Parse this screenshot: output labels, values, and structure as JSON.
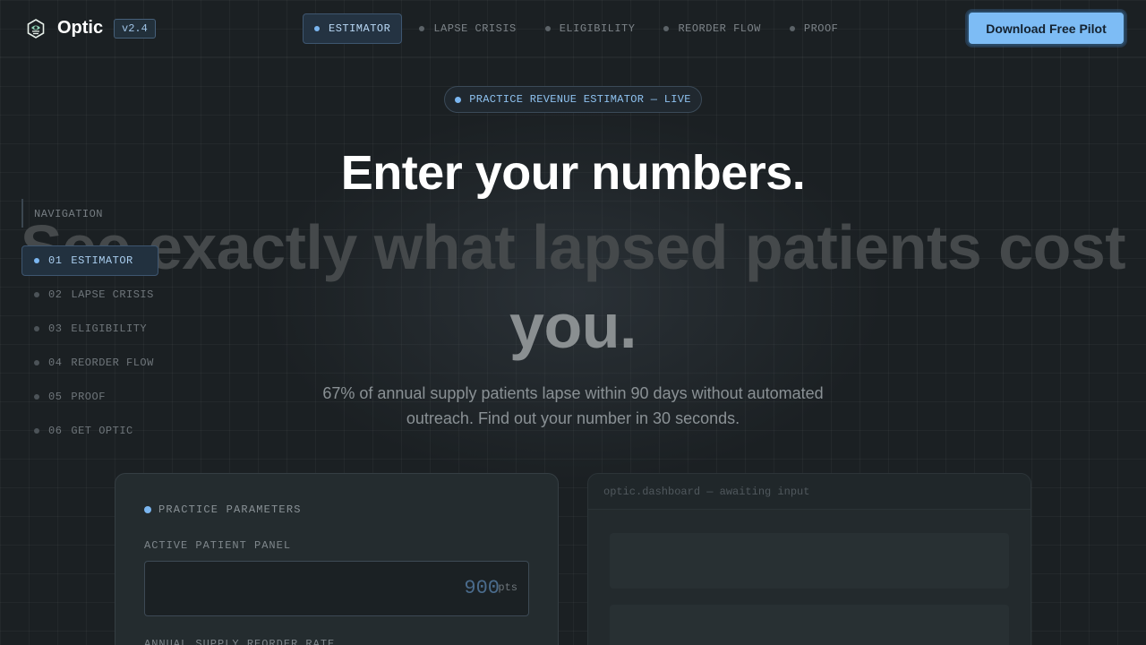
{
  "header": {
    "brand": "Optic",
    "version": "v2.4",
    "nav": [
      {
        "label": "ESTIMATOR",
        "active": true
      },
      {
        "label": "LAPSE CRISIS",
        "active": false
      },
      {
        "label": "ELIGIBILITY",
        "active": false
      },
      {
        "label": "REORDER FLOW",
        "active": false
      },
      {
        "label": "PROOF",
        "active": false
      }
    ],
    "cta_label": "Download Free Pilot"
  },
  "hero": {
    "pill": "PRACTICE REVENUE ESTIMATOR — LIVE",
    "headline": "Enter your numbers.",
    "subheadline_main": "See exactly what lapsed patients cost",
    "subheadline_highlight": "you.",
    "description": "67% of annual supply patients lapse within 90 days without automated outreach. Find out your number in 30 seconds."
  },
  "sidebar": {
    "heading": "NAVIGATION",
    "items": [
      {
        "num": "01",
        "label": "ESTIMATOR",
        "active": true
      },
      {
        "num": "02",
        "label": "LAPSE CRISIS",
        "active": false
      },
      {
        "num": "03",
        "label": "ELIGIBILITY",
        "active": false
      },
      {
        "num": "04",
        "label": "REORDER FLOW",
        "active": false
      },
      {
        "num": "05",
        "label": "PROOF",
        "active": false
      },
      {
        "num": "06",
        "label": "GET OPTIC",
        "active": false
      }
    ]
  },
  "params_card": {
    "title": "PRACTICE PARAMETERS",
    "panel_label": "ACTIVE PATIENT PANEL",
    "panel_value": "900",
    "panel_unit": "pts",
    "reorder_label": "ANNUAL SUPPLY REORDER RATE"
  },
  "dashboard_card": {
    "titlebar": "optic.dashboard — awaiting input"
  },
  "colors": {
    "background": "#1b2023",
    "accent": "#7dbcf5",
    "headline": "#ffffff",
    "muted_headline": "#45494b"
  },
  "icons": {
    "logo": "optic-logo-icon"
  }
}
